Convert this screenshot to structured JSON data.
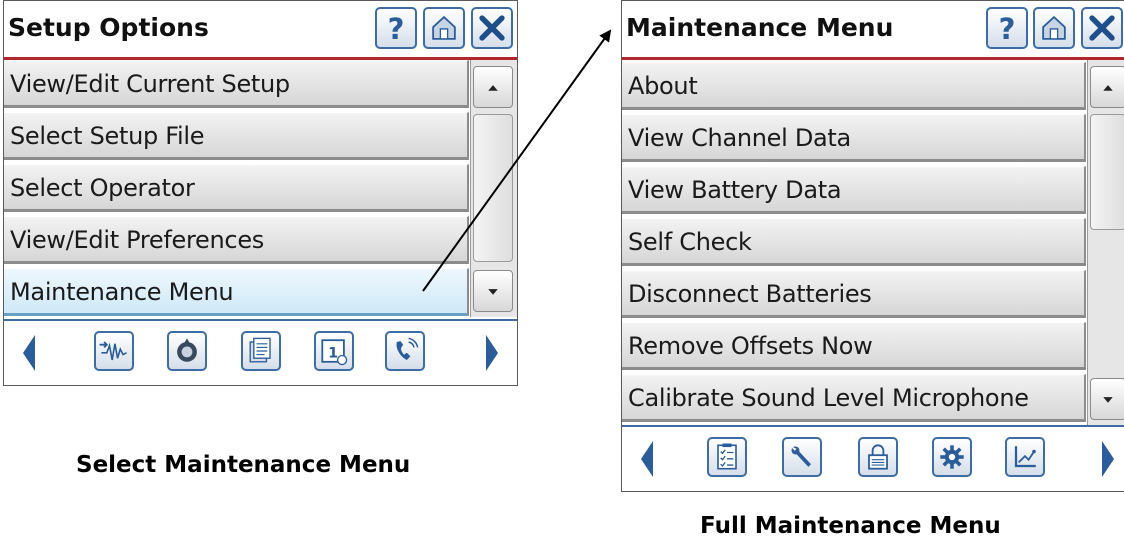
{
  "screen1": {
    "title": "Setup Options",
    "header_icons": [
      "help-icon",
      "home-icon",
      "close-icon"
    ],
    "items": [
      {
        "label": "View/Edit Current Setup"
      },
      {
        "label": "Select Setup File"
      },
      {
        "label": "Select Operator"
      },
      {
        "label": "View/Edit Preferences"
      },
      {
        "label": "Maintenance Menu",
        "selected": true
      }
    ],
    "toolbar_icons": [
      "left-arrow-icon",
      "waveform-icon",
      "badge-icon",
      "documents-icon",
      "calendar-icon",
      "phone-icon",
      "right-arrow-icon"
    ]
  },
  "screen2": {
    "title": "Maintenance Menu",
    "header_icons": [
      "help-icon",
      "home-icon",
      "close-icon"
    ],
    "items": [
      {
        "label": "About"
      },
      {
        "label": "View Channel Data"
      },
      {
        "label": "View Battery Data"
      },
      {
        "label": "Self Check"
      },
      {
        "label": "Disconnect Batteries"
      },
      {
        "label": "Remove Offsets Now"
      },
      {
        "label": "Calibrate Sound Level Microphone"
      }
    ],
    "toolbar_icons": [
      "left-arrow-icon",
      "checklist-icon",
      "wrench-icon",
      "lock-icon",
      "gear-icon",
      "chart-icon",
      "right-arrow-icon"
    ]
  },
  "captions": {
    "left": "Select Maintenance Menu",
    "right": "Full Maintenance Menu"
  },
  "colors": {
    "accent_blue": "#3d6da4",
    "title_underline": "#b0282b",
    "selected_row": "#cfe9f8"
  }
}
